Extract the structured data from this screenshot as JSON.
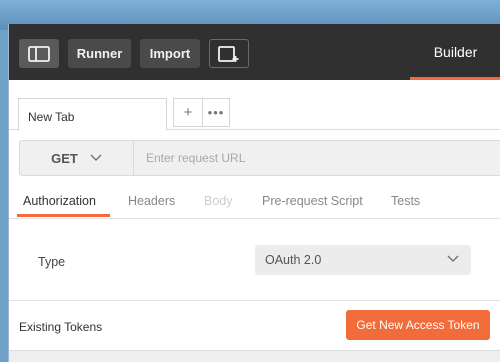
{
  "header": {
    "runner_label": "Runner",
    "import_label": "Import",
    "builder_label": "Builder"
  },
  "tabs": {
    "items": [
      {
        "label": "New Tab"
      }
    ],
    "add_label": "+",
    "more_label": "•••"
  },
  "request": {
    "method": "GET",
    "url_placeholder": "Enter request URL",
    "url_value": ""
  },
  "subtabs": [
    {
      "label": "Authorization",
      "state": "active"
    },
    {
      "label": "Headers",
      "state": "normal"
    },
    {
      "label": "Body",
      "state": "disabled"
    },
    {
      "label": "Pre-request Script",
      "state": "normal"
    },
    {
      "label": "Tests",
      "state": "normal"
    }
  ],
  "auth": {
    "type_label": "Type",
    "type_value": "OAuth 2.0",
    "existing_tokens_label": "Existing Tokens",
    "get_token_label": "Get New Access Token"
  },
  "colors": {
    "accent": "#f26b3a",
    "header_bg": "#303030"
  },
  "icons": {
    "sidebar": "sidebar-toggle-icon",
    "new_window": "new-window-icon",
    "chevron": "chevron-down-icon"
  }
}
